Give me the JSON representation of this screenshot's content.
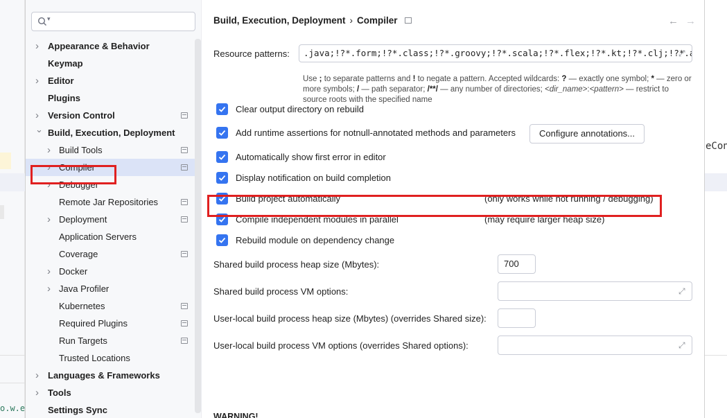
{
  "background": {
    "right_fragment": "eCon",
    "left_fragment": "o.w.e"
  },
  "sidebar": {
    "search_placeholder": "",
    "items": [
      {
        "label": "Appearance & Behavior",
        "level": 0,
        "chevron": "right",
        "proj": false
      },
      {
        "label": "Keymap",
        "level": 0,
        "chevron": "",
        "proj": false
      },
      {
        "label": "Editor",
        "level": 0,
        "chevron": "right",
        "proj": false
      },
      {
        "label": "Plugins",
        "level": 0,
        "chevron": "",
        "proj": false
      },
      {
        "label": "Version Control",
        "level": 0,
        "chevron": "right",
        "proj": true
      },
      {
        "label": "Build, Execution, Deployment",
        "level": 0,
        "chevron": "down",
        "proj": false
      },
      {
        "label": "Build Tools",
        "level": 1,
        "chevron": "right",
        "proj": true
      },
      {
        "label": "Compiler",
        "level": 1,
        "chevron": "right",
        "proj": true,
        "selected": true
      },
      {
        "label": "Debugger",
        "level": 1,
        "chevron": "right",
        "proj": false
      },
      {
        "label": "Remote Jar Repositories",
        "level": 1,
        "chevron": "",
        "proj": true
      },
      {
        "label": "Deployment",
        "level": 1,
        "chevron": "right",
        "proj": true
      },
      {
        "label": "Application Servers",
        "level": 1,
        "chevron": "",
        "proj": false
      },
      {
        "label": "Coverage",
        "level": 1,
        "chevron": "",
        "proj": true
      },
      {
        "label": "Docker",
        "level": 1,
        "chevron": "right",
        "proj": false
      },
      {
        "label": "Java Profiler",
        "level": 1,
        "chevron": "right",
        "proj": false
      },
      {
        "label": "Kubernetes",
        "level": 1,
        "chevron": "",
        "proj": true
      },
      {
        "label": "Required Plugins",
        "level": 1,
        "chevron": "",
        "proj": true
      },
      {
        "label": "Run Targets",
        "level": 1,
        "chevron": "",
        "proj": true
      },
      {
        "label": "Trusted Locations",
        "level": 1,
        "chevron": "",
        "proj": false
      },
      {
        "label": "Languages & Frameworks",
        "level": 0,
        "chevron": "right",
        "proj": false
      },
      {
        "label": "Tools",
        "level": 0,
        "chevron": "right",
        "proj": false
      },
      {
        "label": "Settings Sync",
        "level": 0,
        "chevron": "",
        "proj": false
      }
    ]
  },
  "breadcrumb": {
    "parent": "Build, Execution, Deployment",
    "separator": "›",
    "current": "Compiler"
  },
  "nav": {
    "back": "←",
    "forward": "→"
  },
  "resource": {
    "label": "Resource patterns:",
    "value": ".java;!?*.form;!?*.class;!?*.groovy;!?*.scala;!?*.flex;!?*.kt;!?*.clj;!?*.aj",
    "hint_parts": [
      {
        "t": "Use ",
        "b": false
      },
      {
        "t": ";",
        "b": true
      },
      {
        "t": " to separate patterns and ",
        "b": false
      },
      {
        "t": "!",
        "b": true
      },
      {
        "t": " to negate a pattern. Accepted wildcards: ",
        "b": false
      },
      {
        "t": "?",
        "b": true
      },
      {
        "t": " — exactly one symbol; ",
        "b": false
      },
      {
        "t": "*",
        "b": true
      },
      {
        "t": " — zero or more symbols; ",
        "b": false
      },
      {
        "t": "/",
        "b": true
      },
      {
        "t": " — path separator; ",
        "b": false
      },
      {
        "t": "/**/",
        "b": true
      },
      {
        "t": " — any number of directories; ",
        "b": false
      },
      {
        "t": "<dir_name>",
        "i": true
      },
      {
        "t": ":",
        "b": false
      },
      {
        "t": "<pattern>",
        "i": true
      },
      {
        "t": " — restrict to source roots with the specified name",
        "b": false
      }
    ]
  },
  "checkboxes": {
    "clear_output": {
      "label": "Clear output directory on rebuild",
      "checked": true
    },
    "runtime_assertions": {
      "label": "Add runtime assertions for notnull-annotated methods and parameters",
      "checked": true
    },
    "show_first_error": {
      "label": "Automatically show first error in editor",
      "checked": true
    },
    "display_notification": {
      "label": "Display notification on build completion",
      "checked": true
    },
    "build_automatically": {
      "label": "Build project automatically",
      "checked": true,
      "note": "(only works while not running / debugging)"
    },
    "compile_parallel": {
      "label": "Compile independent modules in parallel",
      "checked": true,
      "note": "(may require larger heap size)"
    },
    "rebuild_module": {
      "label": "Rebuild module on dependency change",
      "checked": true
    }
  },
  "configure_button": "Configure annotations...",
  "fields": {
    "shared_heap": {
      "label": "Shared build process heap size (Mbytes):",
      "value": "700"
    },
    "shared_vm": {
      "label": "Shared build process VM options:",
      "value": ""
    },
    "user_heap": {
      "label": "User-local build process heap size (Mbytes) (overrides Shared size):",
      "value": ""
    },
    "user_vm": {
      "label": "User-local build process VM options (overrides Shared options):",
      "value": ""
    }
  },
  "warning": "WARNING!",
  "colors": {
    "accent": "#3574f0",
    "highlight": "#e02020",
    "selected": "#dbe3f7"
  }
}
